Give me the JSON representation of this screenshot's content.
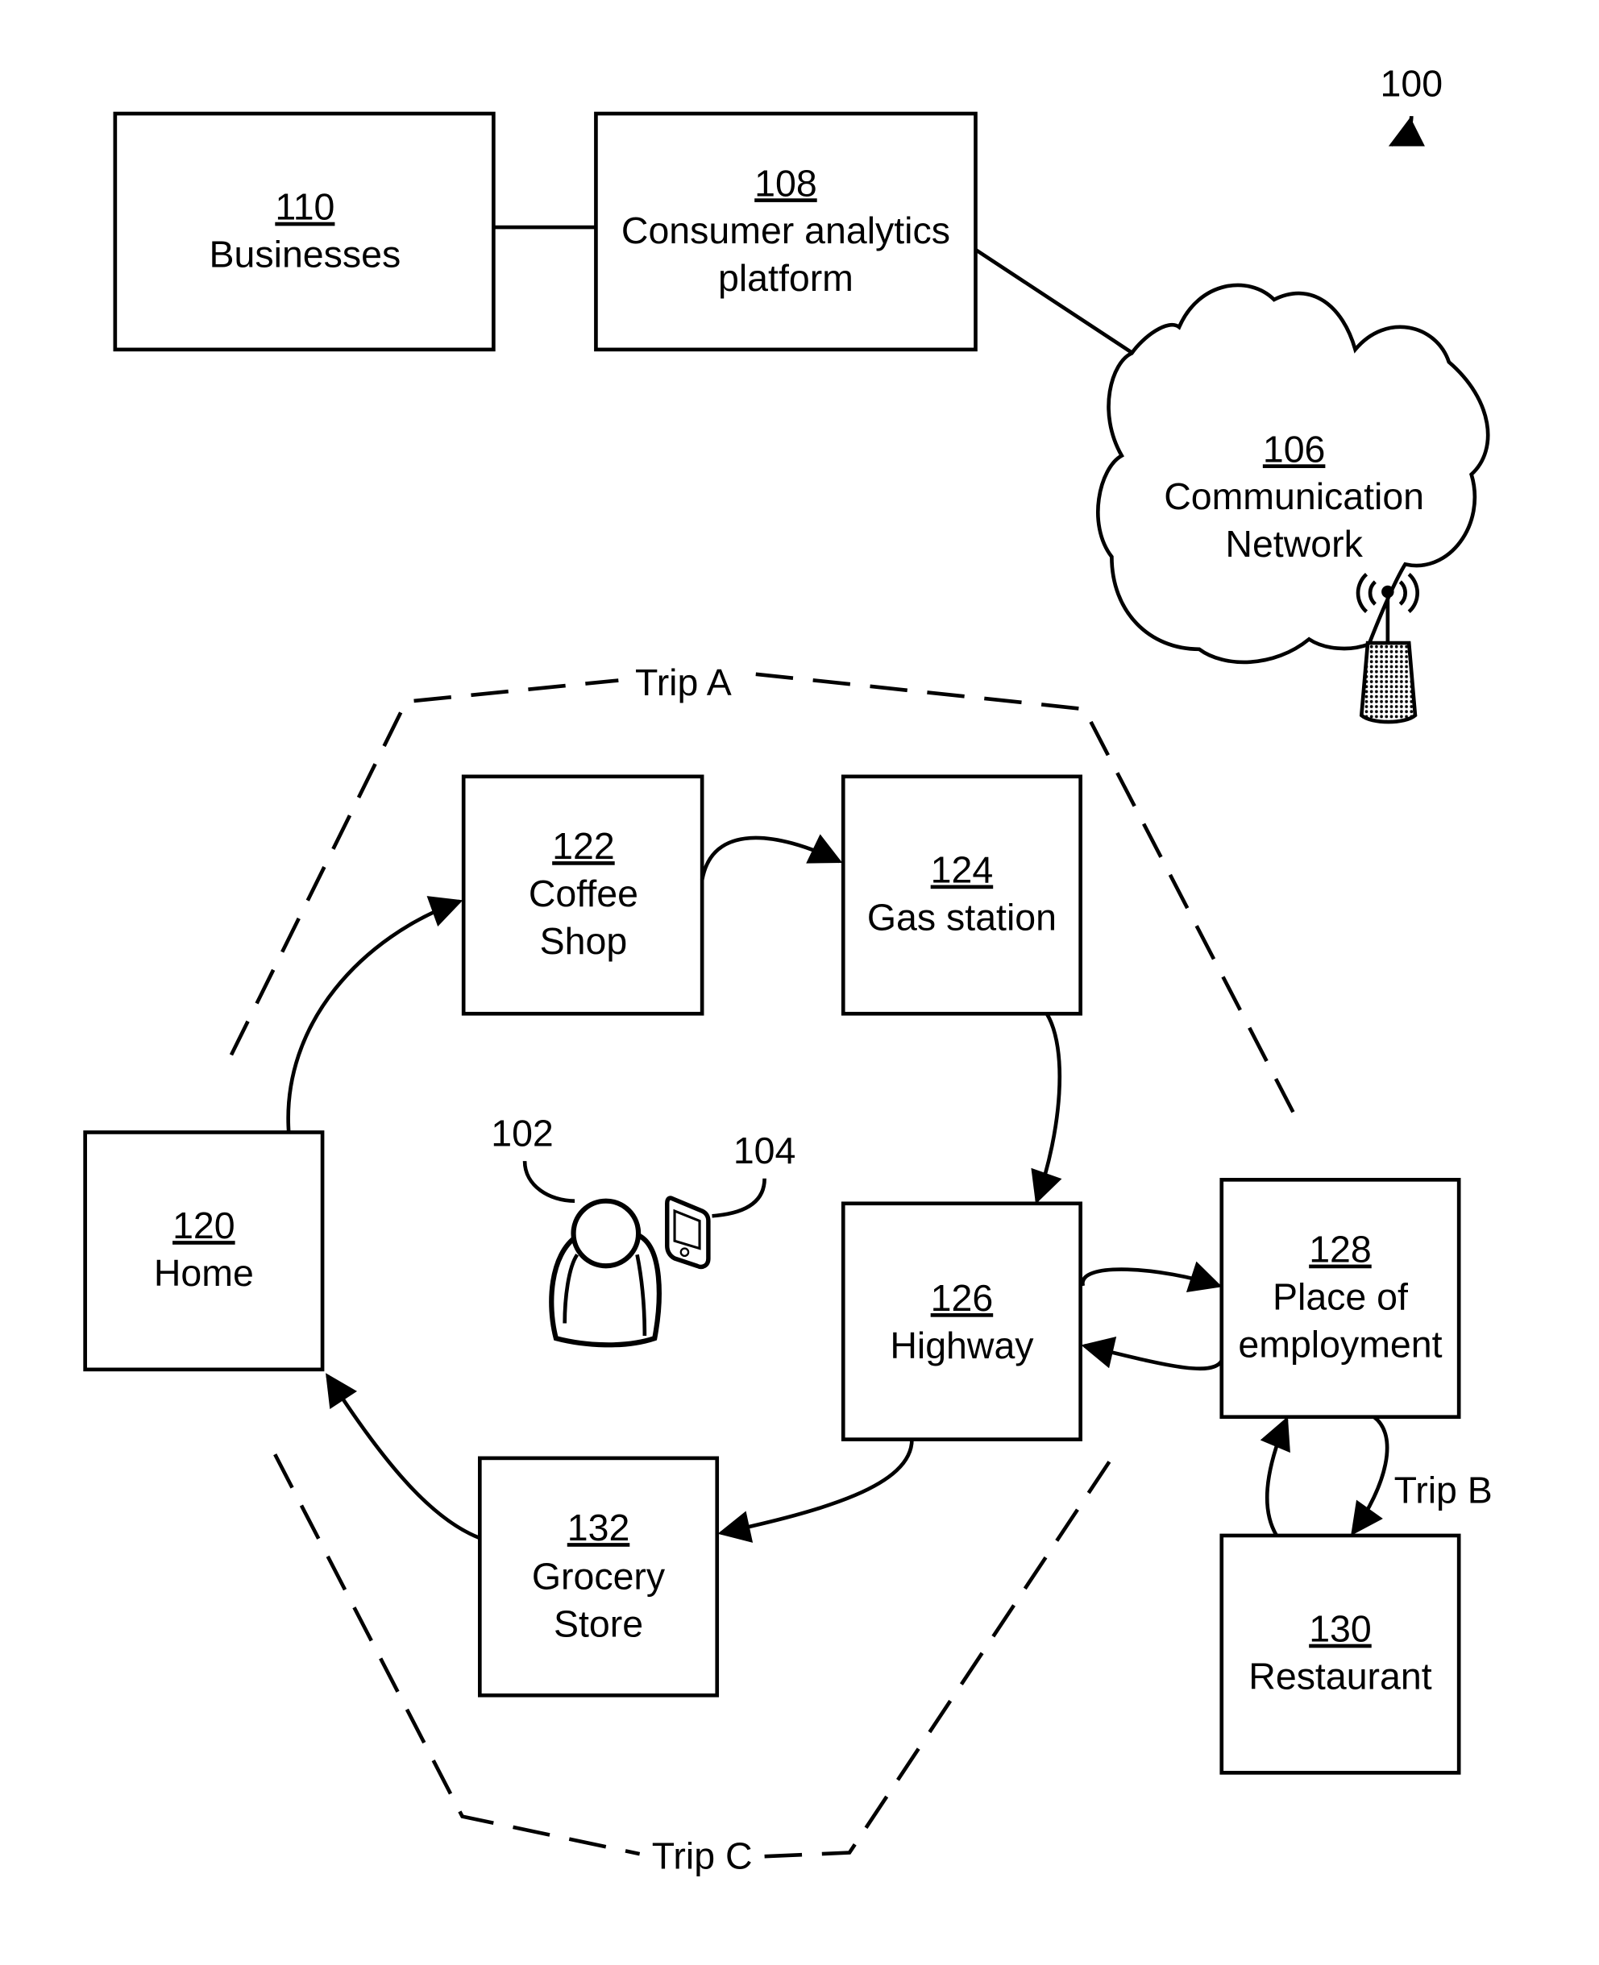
{
  "figure": {
    "reference": "100",
    "nodes": {
      "businesses": {
        "number": "110",
        "label": [
          "Businesses"
        ]
      },
      "platform": {
        "number": "108",
        "label": [
          "Consumer analytics",
          "platform"
        ]
      },
      "network": {
        "number": "106",
        "label": [
          "Communication",
          "Network"
        ]
      },
      "home": {
        "number": "120",
        "label": [
          "Home"
        ]
      },
      "coffee": {
        "number": "122",
        "label": [
          "Coffee",
          "Shop"
        ]
      },
      "gas": {
        "number": "124",
        "label": [
          "Gas station"
        ]
      },
      "highway": {
        "number": "126",
        "label": [
          "Highway"
        ]
      },
      "employment": {
        "number": "128",
        "label": [
          "Place of",
          "employment"
        ]
      },
      "restaurant": {
        "number": "130",
        "label": [
          "Restaurant"
        ]
      },
      "grocery": {
        "number": "132",
        "label": [
          "Grocery",
          "Store"
        ]
      }
    },
    "user": {
      "number": "102"
    },
    "device": {
      "number": "104"
    },
    "trips": {
      "a": "Trip A",
      "b": "Trip B",
      "c": "Trip C"
    }
  }
}
